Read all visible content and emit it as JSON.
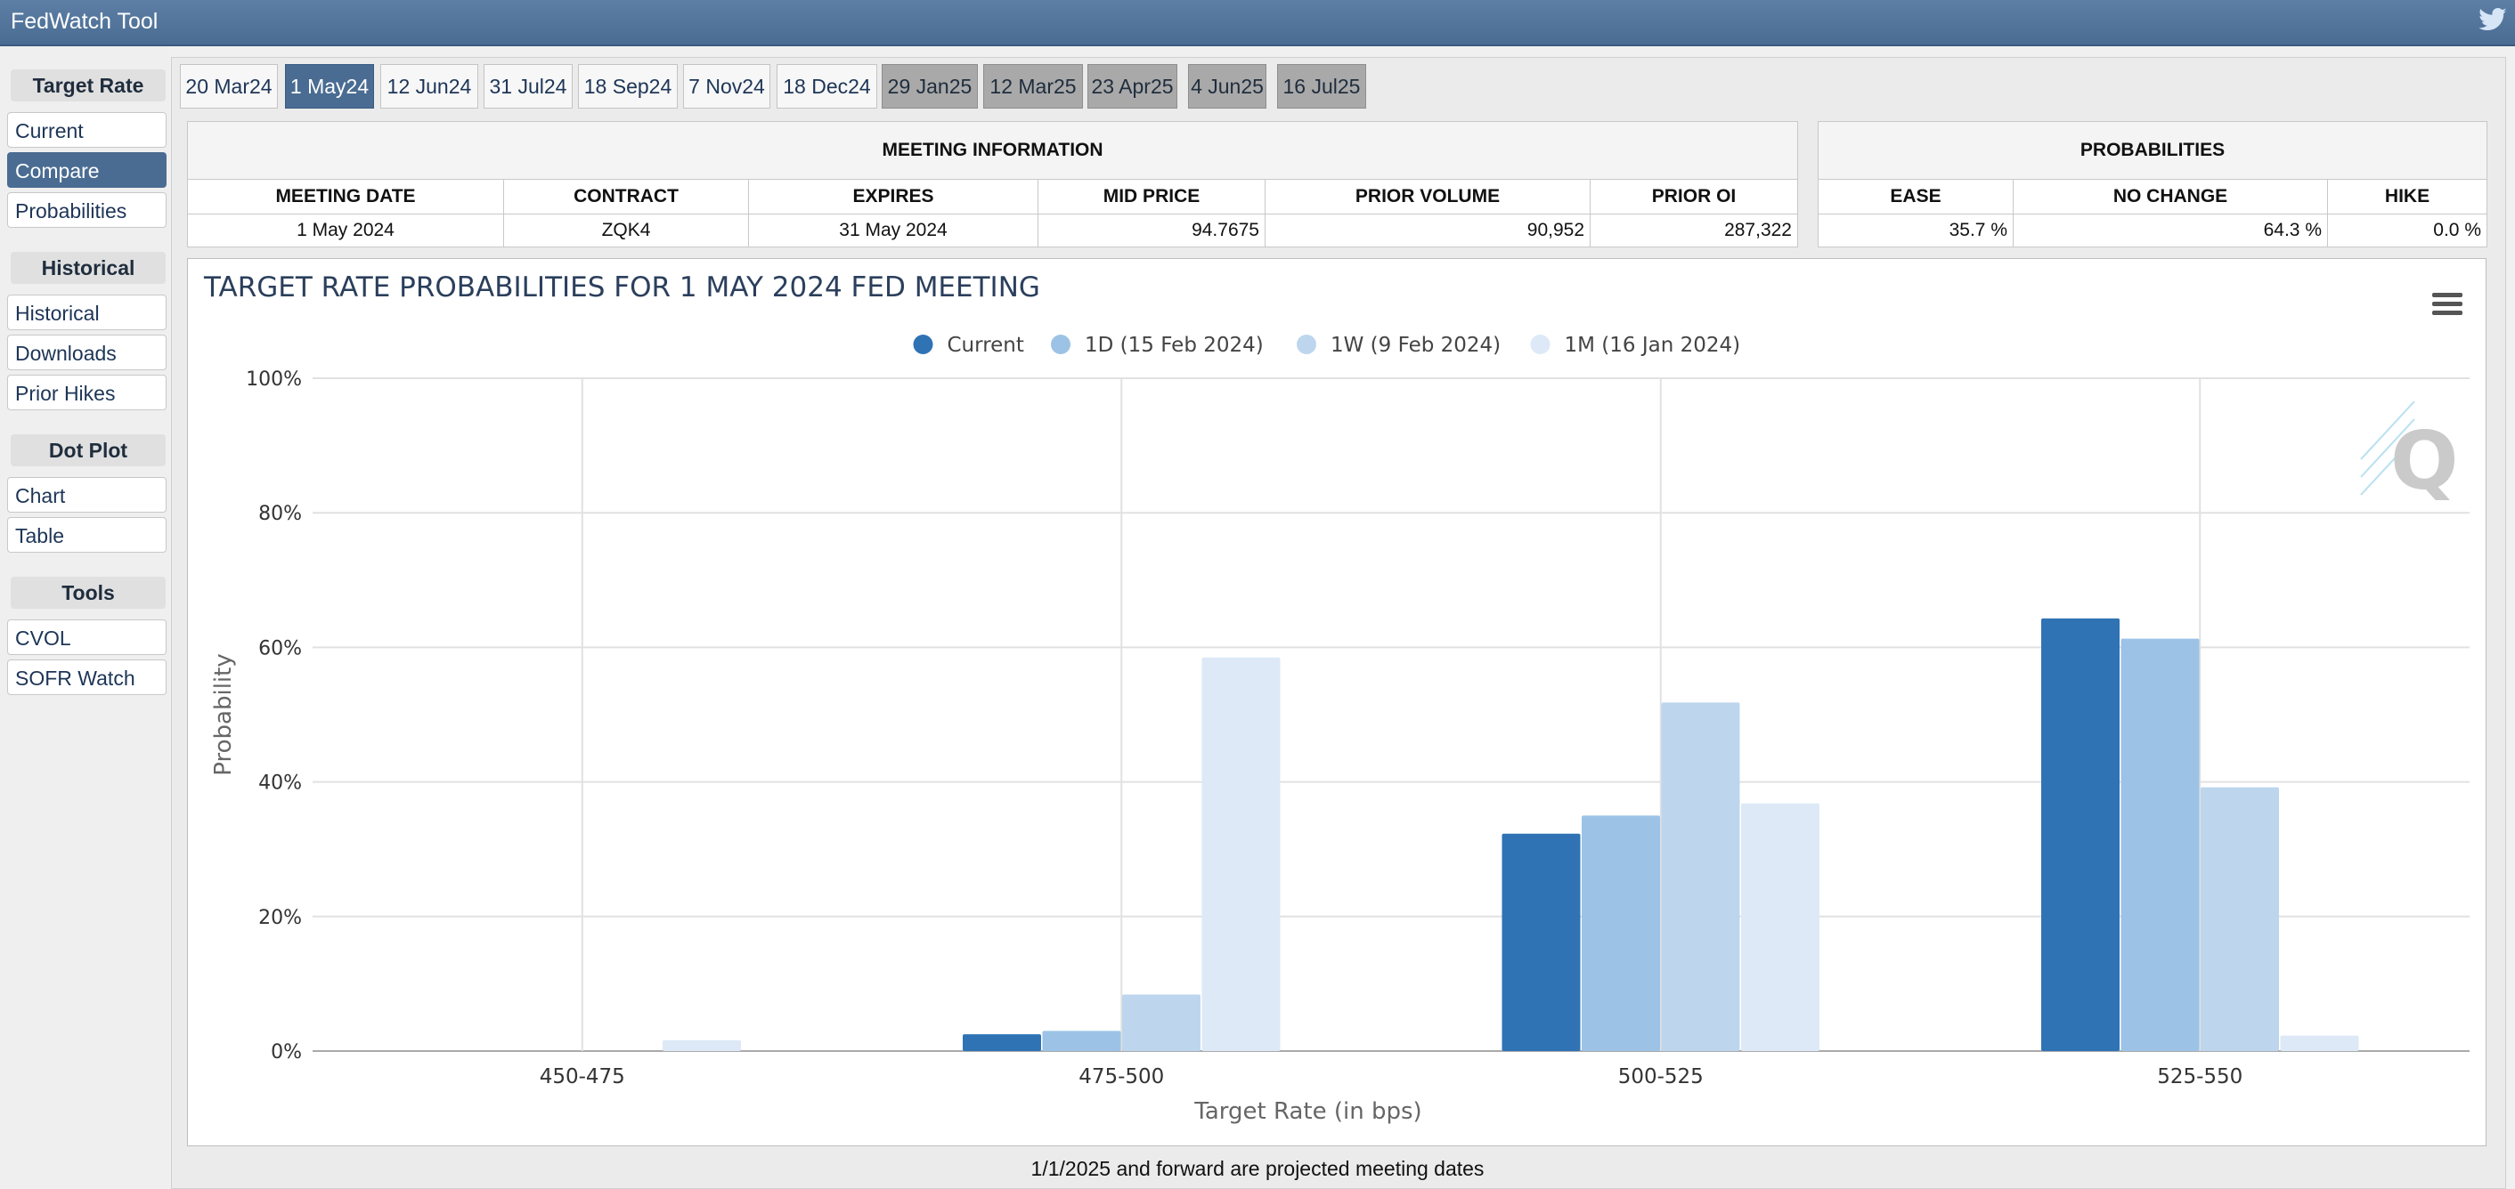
{
  "app": {
    "title": "FedWatch Tool"
  },
  "sidebar": {
    "sections": [
      {
        "heading": "Target Rate",
        "items": [
          "Current",
          "Compare",
          "Probabilities"
        ]
      },
      {
        "heading": "Historical",
        "items": [
          "Historical",
          "Downloads",
          "Prior Hikes"
        ]
      },
      {
        "heading": "Dot Plot",
        "items": [
          "Chart",
          "Table"
        ]
      },
      {
        "heading": "Tools",
        "items": [
          "CVOL",
          "SOFR Watch"
        ]
      }
    ],
    "active_item": "Compare"
  },
  "tabs": [
    {
      "label": "20 Mar24",
      "state": "normal"
    },
    {
      "label": "1 May24",
      "state": "active"
    },
    {
      "label": "12 Jun24",
      "state": "normal"
    },
    {
      "label": "31 Jul24",
      "state": "normal"
    },
    {
      "label": "18 Sep24",
      "state": "normal"
    },
    {
      "label": "7 Nov24",
      "state": "normal"
    },
    {
      "label": "18 Dec24",
      "state": "normal"
    },
    {
      "label": "29 Jan25",
      "state": "projected"
    },
    {
      "label": "12 Mar25",
      "state": "projected"
    },
    {
      "label": "23 Apr25",
      "state": "projected"
    },
    {
      "label": "4 Jun25",
      "state": "projected"
    },
    {
      "label": "16 Jul25",
      "state": "projected"
    }
  ],
  "meeting_info": {
    "caption": "MEETING INFORMATION",
    "headers": [
      "MEETING DATE",
      "CONTRACT",
      "EXPIRES",
      "MID PRICE",
      "PRIOR VOLUME",
      "PRIOR OI"
    ],
    "row": [
      "1 May 2024",
      "ZQK4",
      "31 May 2024",
      "94.7675",
      "90,952",
      "287,322"
    ]
  },
  "probabilities": {
    "caption": "PROBABILITIES",
    "headers": [
      "EASE",
      "NO CHANGE",
      "HIKE"
    ],
    "row": [
      "35.7 %",
      "64.3 %",
      "0.0 %"
    ]
  },
  "chart_data": {
    "type": "bar",
    "title": "TARGET RATE PROBABILITIES FOR 1 MAY 2024 FED MEETING",
    "xlabel": "Target Rate (in bps)",
    "ylabel": "Probability",
    "categories": [
      "450-475",
      "475-500",
      "500-525",
      "525-550"
    ],
    "yticks": [
      "0%",
      "20%",
      "40%",
      "60%",
      "80%",
      "100%"
    ],
    "ylim": [
      0,
      100
    ],
    "grid": true,
    "legend_position": "top-center",
    "series": [
      {
        "name": "Current",
        "color": "#2f73b5",
        "values": [
          0.0,
          2.5,
          32.3,
          64.3
        ]
      },
      {
        "name": "1D (15 Feb 2024)",
        "color": "#9cc3e6",
        "values": [
          0.0,
          3.0,
          35.0,
          61.3
        ]
      },
      {
        "name": "1W (9 Feb 2024)",
        "color": "#bdd6ee",
        "values": [
          0.0,
          8.4,
          51.8,
          39.2
        ]
      },
      {
        "name": "1M (16 Jan 2024)",
        "color": "#dde9f6",
        "values": [
          1.6,
          58.5,
          36.8,
          2.3
        ]
      }
    ]
  },
  "footer": {
    "note": "1/1/2025 and forward are projected meeting dates"
  }
}
